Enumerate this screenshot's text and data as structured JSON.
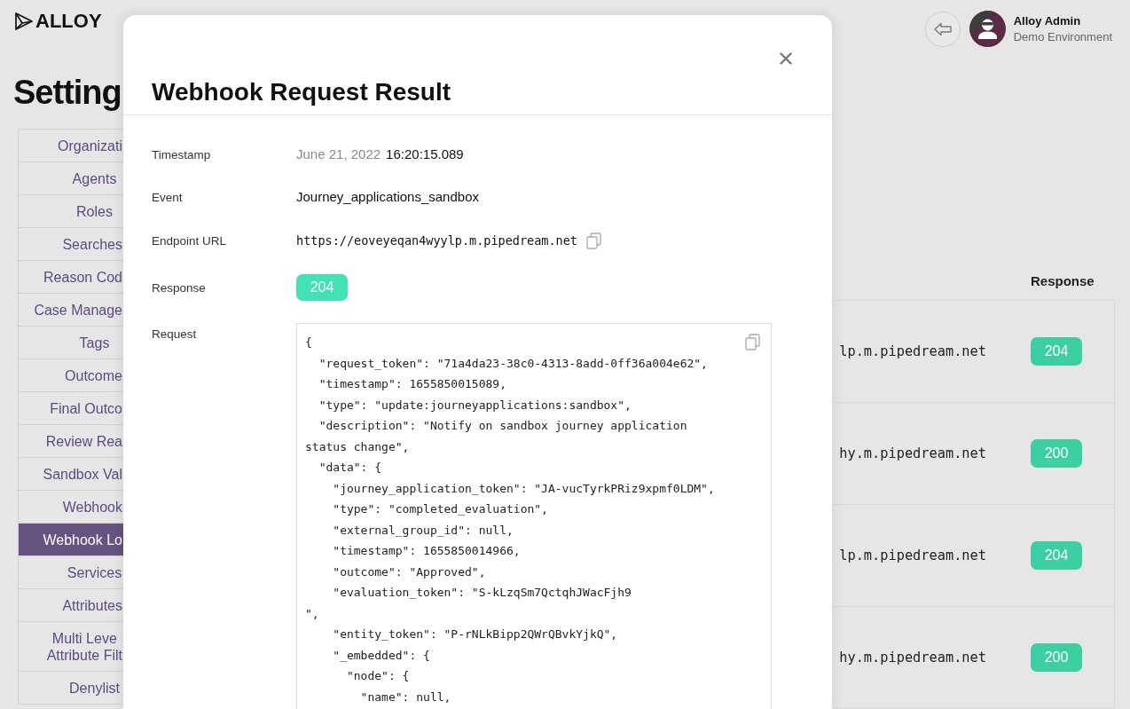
{
  "header": {
    "logo": "ALLOY",
    "user_name": "Alloy Admin",
    "environment": "Demo Environment"
  },
  "settings": {
    "title": "Setting",
    "items": [
      {
        "label": "Organizati",
        "selected": false
      },
      {
        "label": "Agents",
        "selected": false
      },
      {
        "label": "Roles",
        "selected": false
      },
      {
        "label": "Searches",
        "selected": false
      },
      {
        "label": "Reason Cod",
        "selected": false
      },
      {
        "label": "Case Manage",
        "selected": false
      },
      {
        "label": "Tags",
        "selected": false
      },
      {
        "label": "Outcome",
        "selected": false
      },
      {
        "label": "Final Outco",
        "selected": false
      },
      {
        "label": "Review Rea",
        "selected": false
      },
      {
        "label": "Sandbox Val",
        "selected": false
      },
      {
        "label": "Webhook",
        "selected": false
      },
      {
        "label": "Webhook Lo",
        "selected": true
      },
      {
        "label": "Services",
        "selected": false
      },
      {
        "label": "Attributes",
        "selected": false
      },
      {
        "label": "Multi Leve\nAttribute Filt",
        "selected": false
      },
      {
        "label": "Denylist",
        "selected": false
      }
    ]
  },
  "log_table": {
    "columns": [
      "Response"
    ],
    "rows": [
      {
        "url": "lp.m.pipedream.net",
        "response": "204"
      },
      {
        "url": "hy.m.pipedream.net",
        "response": "200"
      },
      {
        "url": "lp.m.pipedream.net",
        "response": "204"
      },
      {
        "url": "hy.m.pipedream.net",
        "response": "200"
      }
    ]
  },
  "modal": {
    "title": "Webhook Request Result",
    "fields": [
      {
        "kind": "timestamp",
        "label": "Timestamp",
        "date": "June 21, 2022",
        "time": "16:20:15.089"
      },
      {
        "kind": "text",
        "label": "Event",
        "value": "Journey_applications_sandbox"
      },
      {
        "kind": "url",
        "label": "Endpoint URL",
        "value": "https://eoveyeqan4wyylp.m.pipedream.net"
      },
      {
        "kind": "status",
        "label": "Response",
        "value": "204"
      },
      {
        "kind": "code",
        "label": "Request",
        "value": "{\n  \"request_token\": \"71a4da23-38c0-4313-8add-0ff36a004e62\",\n  \"timestamp\": 1655850015089,\n  \"type\": \"update:journeyapplications:sandbox\",\n  \"description\": \"Notify on sandbox journey application\nstatus change\",\n  \"data\": {\n    \"journey_application_token\": \"JA-vucTyrkPRiz9xpmf0LDM\",\n    \"type\": \"completed_evaluation\",\n    \"external_group_id\": null,\n    \"timestamp\": 1655850014966,\n    \"outcome\": \"Approved\",\n    \"evaluation_token\": \"S-kLzqSm7QctqhJWacFjh9\n\",\n    \"entity_token\": \"P-rNLkBipp2QWrQBvkYjkQ\",\n    \"_embedded\": {\n      \"node\": {\n        \"name\": null,"
      }
    ]
  }
}
